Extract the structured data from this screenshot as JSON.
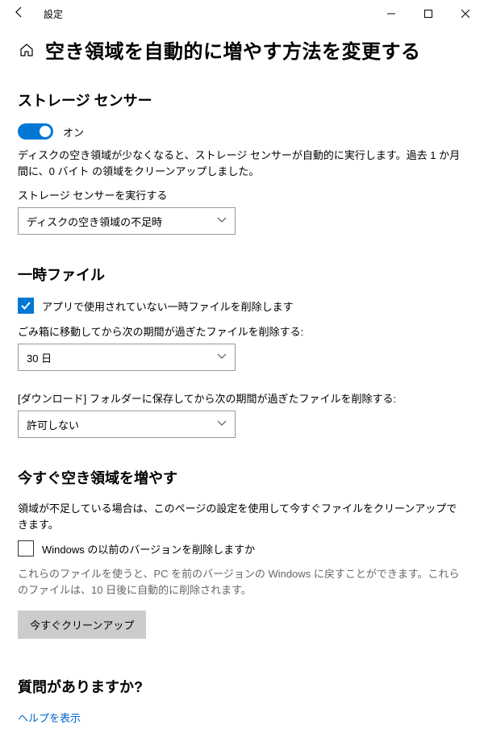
{
  "window": {
    "title": "設定"
  },
  "page": {
    "heading": "空き領域を自動的に増やす方法を変更する"
  },
  "storage_sense": {
    "heading": "ストレージ センサー",
    "toggle_state": "オン",
    "description": "ディスクの空き領域が少なくなると、ストレージ センサーが自動的に実行します。過去 1 か月間に、0 バイト の領域をクリーンアップしました。",
    "run_label": "ストレージ センサーを実行する",
    "run_value": "ディスクの空き領域の不足時"
  },
  "temp_files": {
    "heading": "一時ファイル",
    "delete_temp_label": "アプリで使用されていない一時ファイルを削除します",
    "recycle_label": "ごみ箱に移動してから次の期間が過ぎたファイルを削除する:",
    "recycle_value": "30 日",
    "downloads_label": "[ダウンロード] フォルダーに保存してから次の期間が過ぎたファイルを削除する:",
    "downloads_value": "許可しない"
  },
  "free_now": {
    "heading": "今すぐ空き領域を増やす",
    "description": "領域が不足している場合は、このページの設定を使用して今すぐファイルをクリーンアップできます。",
    "prev_versions_label": "Windows の以前のバージョンを削除しますか",
    "prev_versions_desc": "これらのファイルを使うと、PC を前のバージョンの Windows に戻すことができます。これらのファイルは、10 日後に自動的に削除されます。",
    "clean_button": "今すぐクリーンアップ"
  },
  "faq": {
    "heading": "質問がありますか?",
    "help_link": "ヘルプを表示"
  }
}
